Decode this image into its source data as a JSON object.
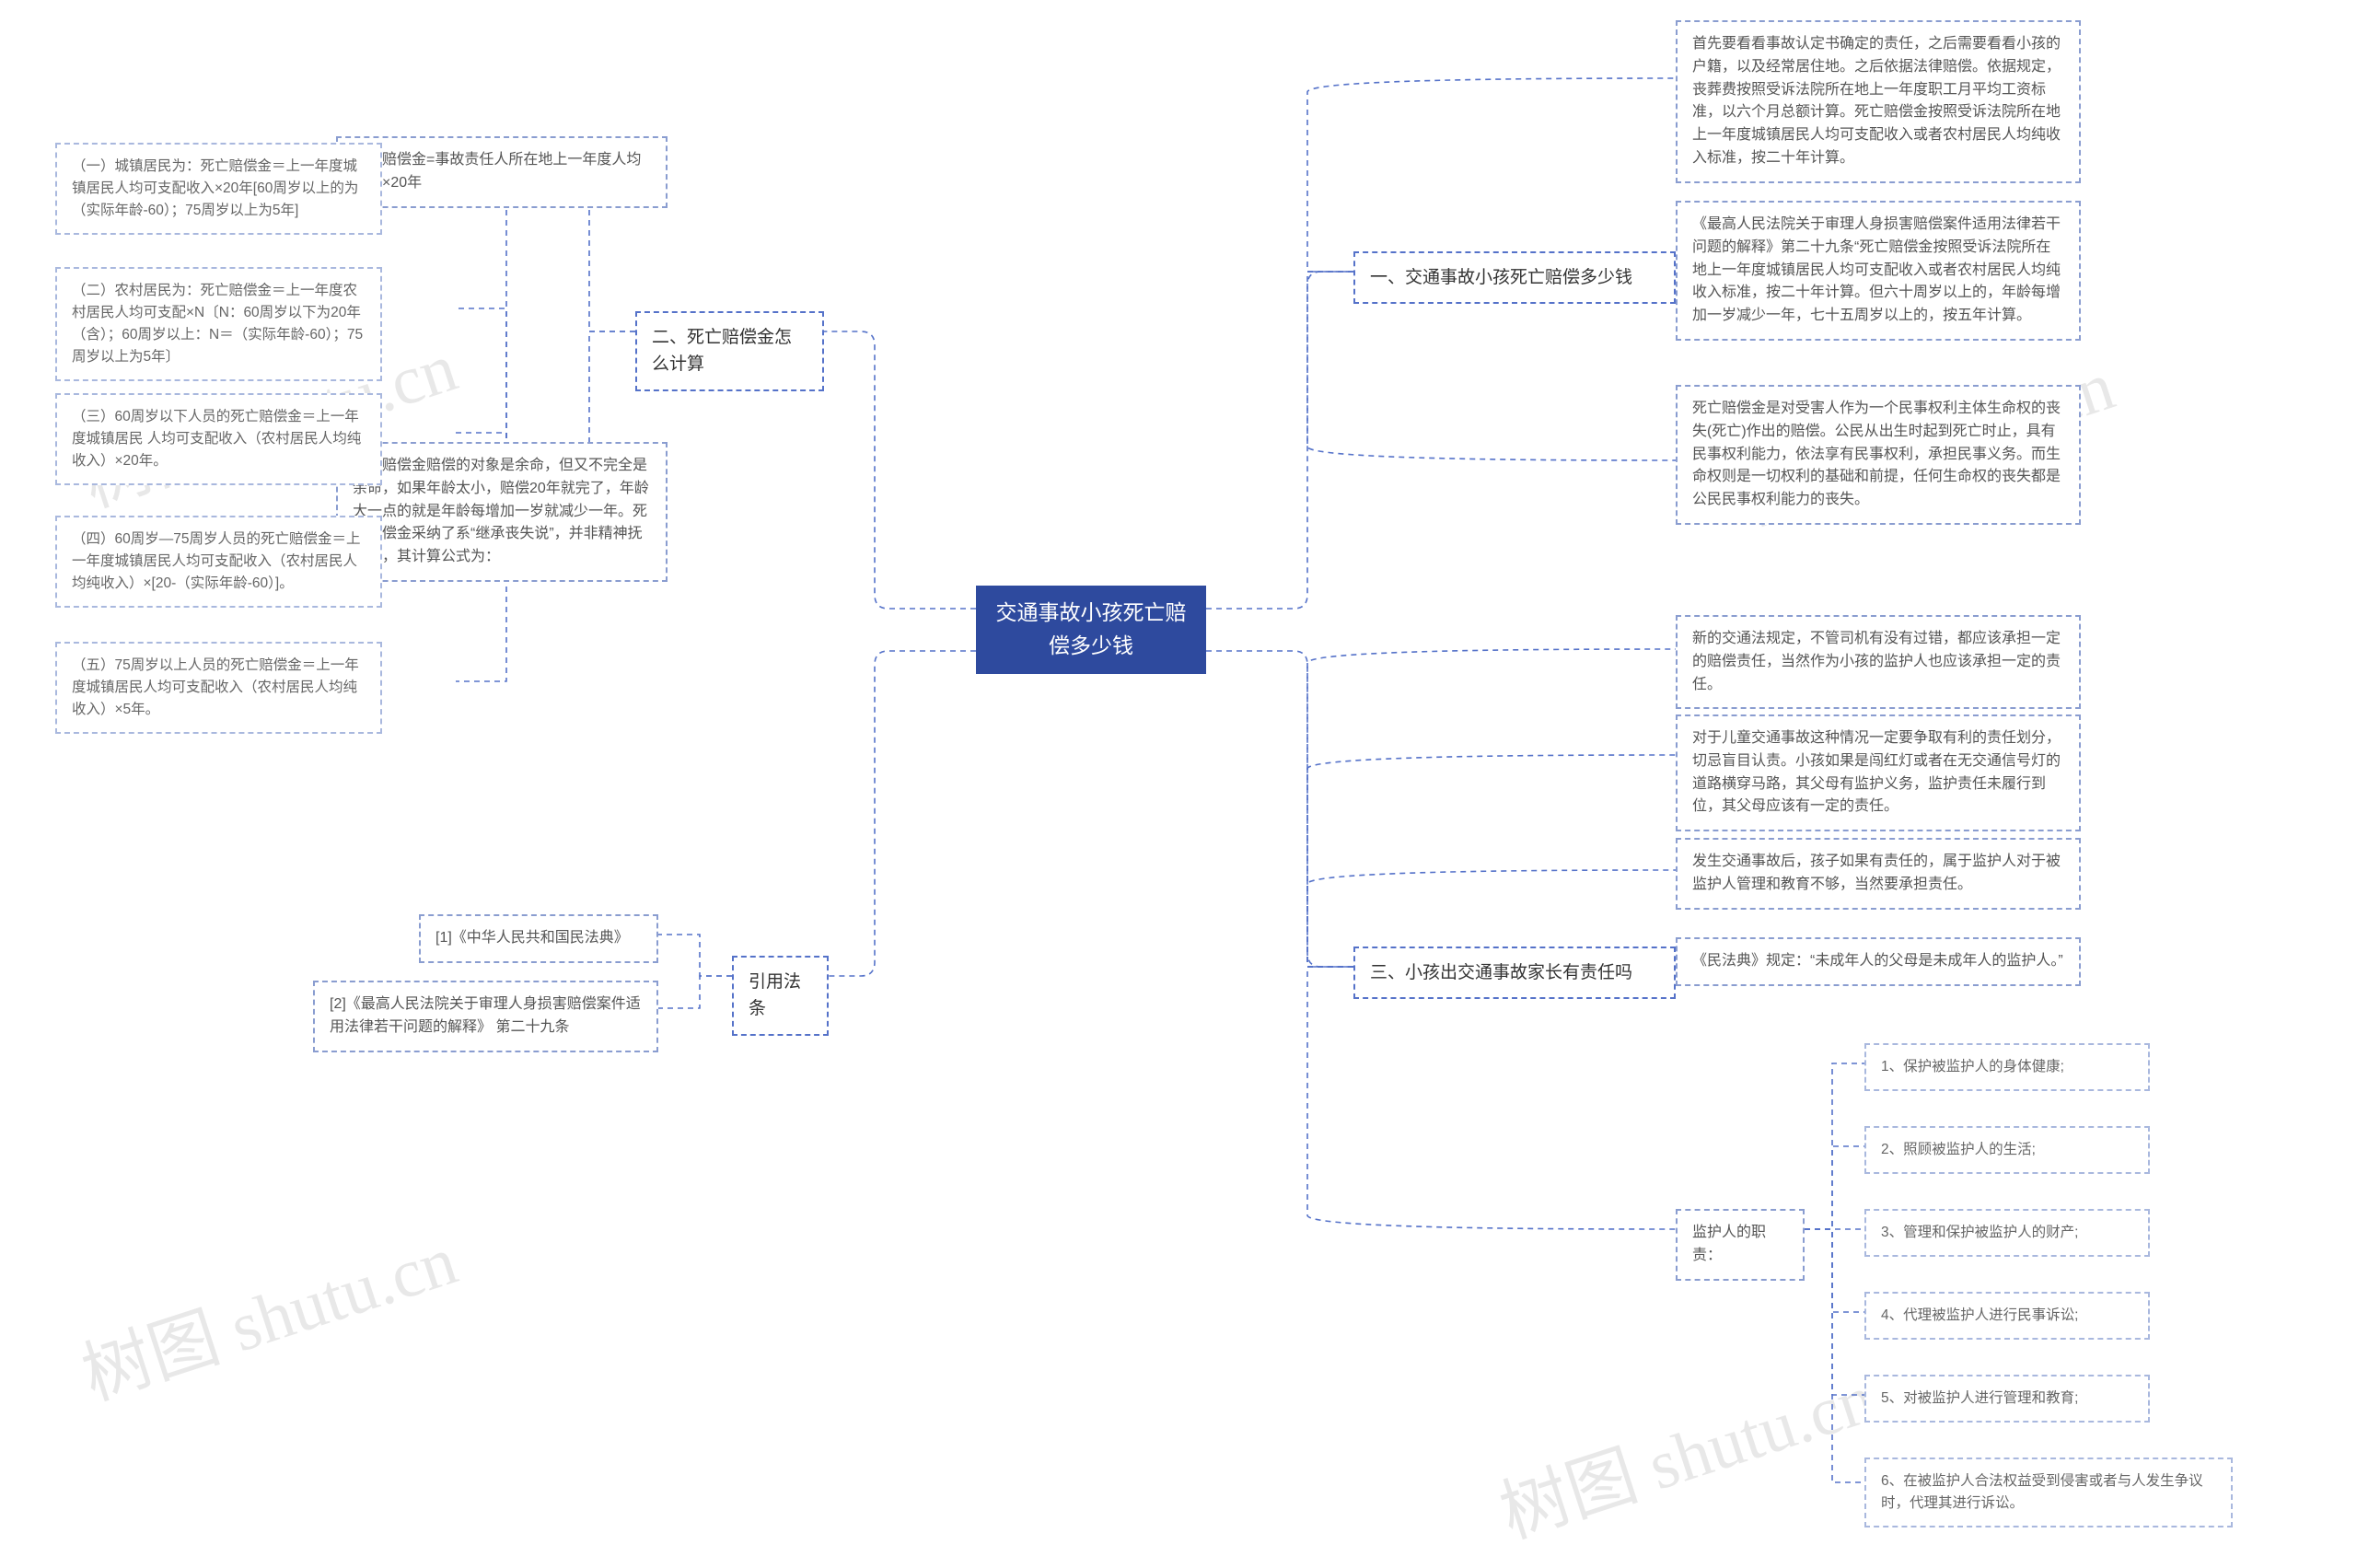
{
  "center": "交通事故小孩死亡赔偿多少钱",
  "watermark": "树图 shutu.cn",
  "branches": {
    "b1": {
      "title": "一、交通事故小孩死亡赔偿多少钱",
      "leaves": [
        "首先要看看事故认定书确定的责任，之后需要看看小孩的户籍，以及经常居住地。之后依据法律赔偿。依据规定，丧葬费按照受诉法院所在地上一年度职工月平均工资标准，以六个月总额计算。死亡赔偿金按照受诉法院所在地上一年度城镇居民人均可支配收入或者农村居民人均纯收入标准，按二十年计算。",
        "《最高人民法院关于审理人身损害赔偿案件适用法律若干问题的解释》第二十九条“死亡赔偿金按照受诉法院所在地上一年度城镇居民人均可支配收入或者农村居民人均纯收入标准，按二十年计算。但六十周岁以上的，年龄每增加一岁减少一年，七十五周岁以上的，按五年计算。",
        "死亡赔偿金是对受害人作为一个民事权利主体生命权的丧失(死亡)作出的赔偿。公民从出生时起到死亡时止，具有民事权利能力，依法享有民事权利，承担民事义务。而生命权则是一切权利的基础和前提，任何生命权的丧失都是公民民事权利能力的丧失。"
      ]
    },
    "b3": {
      "title": "三、小孩出交通事故家长有责任吗",
      "leaves": [
        "新的交通法规定，不管司机有没有过错，都应该承担一定的赔偿责任，当然作为小孩的监护人也应该承担一定的责任。",
        "对于儿童交通事故这种情况一定要争取有利的责任划分，切忌盲目认责。小孩如果是闯红灯或者在无交通信号灯的道路横穿马路，其父母有监护义务，监护责任未履行到位，其父母应该有一定的责任。",
        "发生交通事故后，孩子如果有责任的，属于监护人对于被监护人管理和教育不够，当然要承担责任。",
        "《民法典》规定：“未成年人的父母是未成年人的监护人。”"
      ],
      "sub": {
        "title": "监护人的职责：",
        "items": [
          "1、保护被监护人的身体健康;",
          "2、照顾被监护人的生活;",
          "3、管理和保护被监护人的财产;",
          "4、代理被监护人进行民事诉讼;",
          "5、对被监护人进行管理和教育;",
          "6、在被监护人合法权益受到侵害或者与人发生争议时，代理其进行诉讼。"
        ]
      }
    },
    "b2": {
      "title": "二、死亡赔偿金怎么计算",
      "leaves": [
        "死亡赔偿金=事故责任人所在地上一年度人均收入×20年",
        "死亡赔偿金赔偿的对象是余命，但又不完全是余命，如果年龄太小，赔偿20年就完了，年龄大一点的就是年龄每增加一岁就减少一年。死亡赔偿金采纳了系“继承丧失说”，并非精神抚慰金，其计算公式为："
      ],
      "subs": [
        "（一）城镇居民为：死亡赔偿金＝上一年度城镇居民人均可支配收入×20年[60周岁以上的为（实际年龄-60）；75周岁以上为5年]",
        "（二）农村居民为：死亡赔偿金＝上一年度农村居民人均可支配×N〔N：60周岁以下为20年（含）；60周岁以上：N＝（实际年龄-60）；75周岁以上为5年〕",
        "（三）60周岁以下人员的死亡赔偿金＝上一年度城镇居民 人均可支配收入（农村居民人均纯收入）×20年。",
        "（四）60周岁—75周岁人员的死亡赔偿金＝上一年度城镇居民人均可支配收入（农村居民人均纯收入）×[20-（实际年龄-60）]。",
        "（五）75周岁以上人员的死亡赔偿金＝上一年度城镇居民人均可支配收入（农村居民人均纯收入）×5年。"
      ]
    },
    "b4": {
      "title": "引用法条",
      "leaves": [
        "[1]《中华人民共和国民法典》",
        "[2]《最高人民法院关于审理人身损害赔偿案件适用法律若干问题的解释》 第二十九条"
      ]
    }
  }
}
